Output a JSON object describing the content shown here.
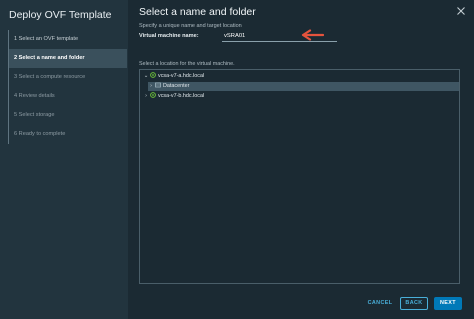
{
  "wizard": {
    "title": "Deploy OVF Template",
    "steps": [
      {
        "label": "1  Select an OVF template",
        "state": "done"
      },
      {
        "label": "2  Select a name and folder",
        "state": "active"
      },
      {
        "label": "3  Select a compute resource",
        "state": "pending"
      },
      {
        "label": "4  Review details",
        "state": "pending"
      },
      {
        "label": "5  Select storage",
        "state": "pending"
      },
      {
        "label": "6  Ready to complete",
        "state": "pending"
      }
    ]
  },
  "main": {
    "title": "Select a name and folder",
    "instruction": "Specify a unique name and target location",
    "vm_name_label": "Virtual machine name:",
    "vm_name_value": "vSRA01",
    "location_label": "Select a location for the virtual machine.",
    "tree": [
      {
        "label": "vcsa-v7-a.hdc.local",
        "expanded": true,
        "icon": "vcenter-icon"
      },
      {
        "label": "Datacenter",
        "expanded": false,
        "icon": "datacenter-icon",
        "selected": true
      },
      {
        "label": "vcsa-v7-b.hdc.local",
        "expanded": false,
        "icon": "vcenter-icon"
      }
    ]
  },
  "footer": {
    "cancel_label": "CANCEL",
    "back_label": "BACK",
    "next_label": "NEXT"
  },
  "colors": {
    "accent": "#0079b8",
    "link": "#49afd9",
    "annotation_arrow": "#e5533d",
    "vcenter_icon": "#6cbf3a"
  }
}
